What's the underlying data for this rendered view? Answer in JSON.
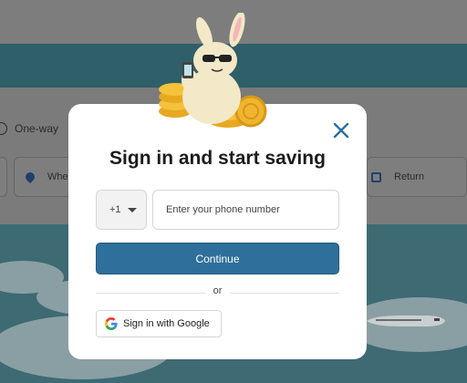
{
  "background": {
    "trip_type_label": "One-way",
    "where_label": "Where",
    "return_label": "Return"
  },
  "modal": {
    "title": "Sign in and start saving",
    "country_code": "+1",
    "phone_placeholder": "Enter your phone number",
    "continue_label": "Continue",
    "divider_text": "or",
    "google_label": "Sign in with Google"
  },
  "colors": {
    "primary_button": "#2e6f9b",
    "close_icon": "#2e6f9b",
    "background_band": "#2f5f68"
  },
  "icons": {
    "close": "close-icon",
    "country_dropdown": "chevron-down-icon",
    "google": "google-logo-icon",
    "where_field": "location-pin-icon",
    "return_field": "calendar-icon"
  }
}
